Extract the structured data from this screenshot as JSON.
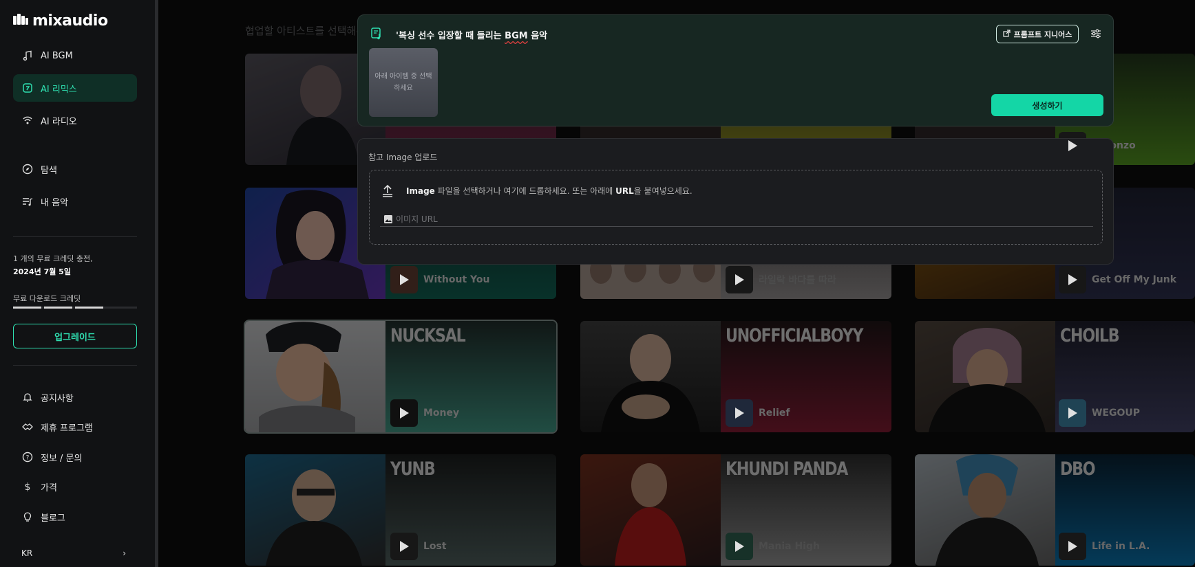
{
  "brand": {
    "logo_text": "mixaudio"
  },
  "sidebar": {
    "nav": [
      {
        "label": "AI BGM",
        "icon": "music-note-icon"
      },
      {
        "label": "AI 리믹스",
        "icon": "remix-icon"
      },
      {
        "label": "AI 라디오",
        "icon": "radio-icon"
      }
    ],
    "nav2": [
      {
        "label": "탐색",
        "icon": "compass-icon"
      },
      {
        "label": "내 음악",
        "icon": "playlist-icon"
      }
    ],
    "credit_text": "1 개의 무료 크레딧 충전,",
    "credit_date": "2024년 7월 5일",
    "download_label": "무료 다운로드 크레딧",
    "upgrade_label": "업그레이드",
    "links": [
      {
        "label": "공지사항",
        "icon": "bell-icon"
      },
      {
        "label": "제휴 프로그램",
        "icon": "handshake-icon"
      },
      {
        "label": "정보 / 문의",
        "icon": "help-icon"
      },
      {
        "label": "가격",
        "icon": "dollar-icon"
      },
      {
        "label": "블로그",
        "icon": "bulb-icon"
      }
    ],
    "language": "KR",
    "language_chevron": "›"
  },
  "main": {
    "section_title": "협업할 아티스트를 선택해주세요",
    "cards": [
      {
        "artist": "",
        "song": ""
      },
      {
        "artist": "",
        "song": ""
      },
      {
        "artist": "",
        "song": ""
      },
      {
        "artist": "",
        "song": "n Gonzo"
      },
      {
        "artist": "",
        "song": "Without You"
      },
      {
        "artist": "",
        "song": "라일락 바다를 따라"
      },
      {
        "artist": "",
        "song": "Get Off My Junk"
      },
      {
        "artist": "NUCKSAL",
        "song": "Money"
      },
      {
        "artist": "UNOFFICIALBOYY",
        "song": "Relief"
      },
      {
        "artist": "CHOILB",
        "song": "WEGOUP"
      },
      {
        "artist": "YUNB",
        "song": "Lost"
      },
      {
        "artist": "KHUNDI PANDA",
        "song": "Mania High"
      },
      {
        "artist": "DBO",
        "song": "Life in L.A."
      }
    ]
  },
  "prompt_panel": {
    "prompt_prefix": "'복싱 선수 입장할 때 들리는 ",
    "prompt_bgm": "BGM",
    "prompt_suffix": " 음악",
    "genius_label": "프롬프트 지니어스",
    "select_tile_text": "아래 아이템 중 선택하세요",
    "generate_label": "생성하기"
  },
  "upload_panel": {
    "title": "참고 Image 업로드",
    "drop_bold1": "Image",
    "drop_text1": " 파일을 선택하거나 여기에 드롭하세요. 또는 아래에 ",
    "drop_bold2": "URL",
    "drop_text2": "을 붙여넣으세요.",
    "url_placeholder": "이미지 URL",
    "url_value": ""
  },
  "colors": {
    "accent": "#14d6a6",
    "active_nav_bg": "#0f2f26",
    "panel_bg": "#172722"
  }
}
